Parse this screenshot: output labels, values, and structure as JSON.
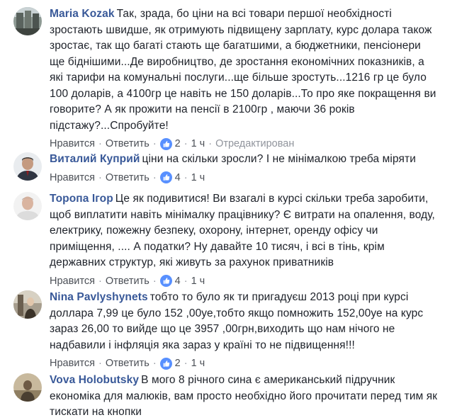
{
  "comments": [
    {
      "author": "Maria Kozak",
      "text": "Так, зрада, бо ціни на всі товари першої необхідності\nзростають швидше, як отримують підвищену зарплату, курс долара також\nзростає, так що багаті стають ще багатшими, а бюджетники, пенсіонери\nще біднішими...Де виробництво, де зростання економічних показників, а\nякі тарифи на комунальні послуги...ще більше зростуть...1216 гр це було\n100 доларів, а 4100гр це навіть не 150 доларів...То про яке покращення ви\nговорите? А як прожити на пенсії в 2100гр , маючи 36 років\nпідстажу?...Спробуйте!",
      "like_label": "Нравится",
      "reply_label": "Ответить",
      "reactions": "2",
      "time": "1 ч",
      "edited": "Отредактирован",
      "avatar_color": "#6f7a74"
    },
    {
      "author": "Виталий Куприй",
      "text": "ціни на скільки зросли? І не мінімалкою треба міряти",
      "like_label": "Нравится",
      "reply_label": "Ответить",
      "reactions": "4",
      "time": "1 ч",
      "avatar_color": "#3f4450"
    },
    {
      "author": "Торопа Ігор",
      "text": "Це як подивитися! Ви взагалі в курсі скільки треба заробити,\nщоб виплатити навіть мінімалку працівнику? Є витрати на опалення, воду,\nелектрику, пожежну безпеку, охорону, інтернет, оренду офісу чи\nприміщення, .... А податки? Ну давайте 10 тисяч, і всі в тінь, крім\nдержавних структур, які живуть за рахунок приватників",
      "like_label": "Нравится",
      "reply_label": "Ответить",
      "reactions": "4",
      "time": "1 ч",
      "avatar_color": "#d8d8d8"
    },
    {
      "author": "Nina Pavlyshynets",
      "text": "тобто то було як ти пригадуєш 2013 році при курсі\nдоллара 7,99 це було 152 ,00уе,тобто якщо помножить 152,00уе на курс\nзараз 26,00 то вийде що це 3957 ,00грн,виходить що нам нічого не\nнадбавили і інфляція яка зараз у країні то не підвищення!!!",
      "like_label": "Нравится",
      "reply_label": "Ответить",
      "reactions": "2",
      "time": "1 ч",
      "avatar_color": "#8a7f70"
    },
    {
      "author": "Vova Holobutsky",
      "text": "В мого 8 річного сина є американський підручник\nекономіка для малюків, вам просто необхідно його прочитати перед тим як\nтискати на кнопки",
      "avatar_color": "#b9a98e"
    }
  ],
  "colors": {
    "author": "#385898",
    "action": "#4b4f56",
    "muted": "#90949c",
    "like_blue": "#5890ff"
  },
  "icons": {
    "reaction": "thumbs-up-icon"
  }
}
